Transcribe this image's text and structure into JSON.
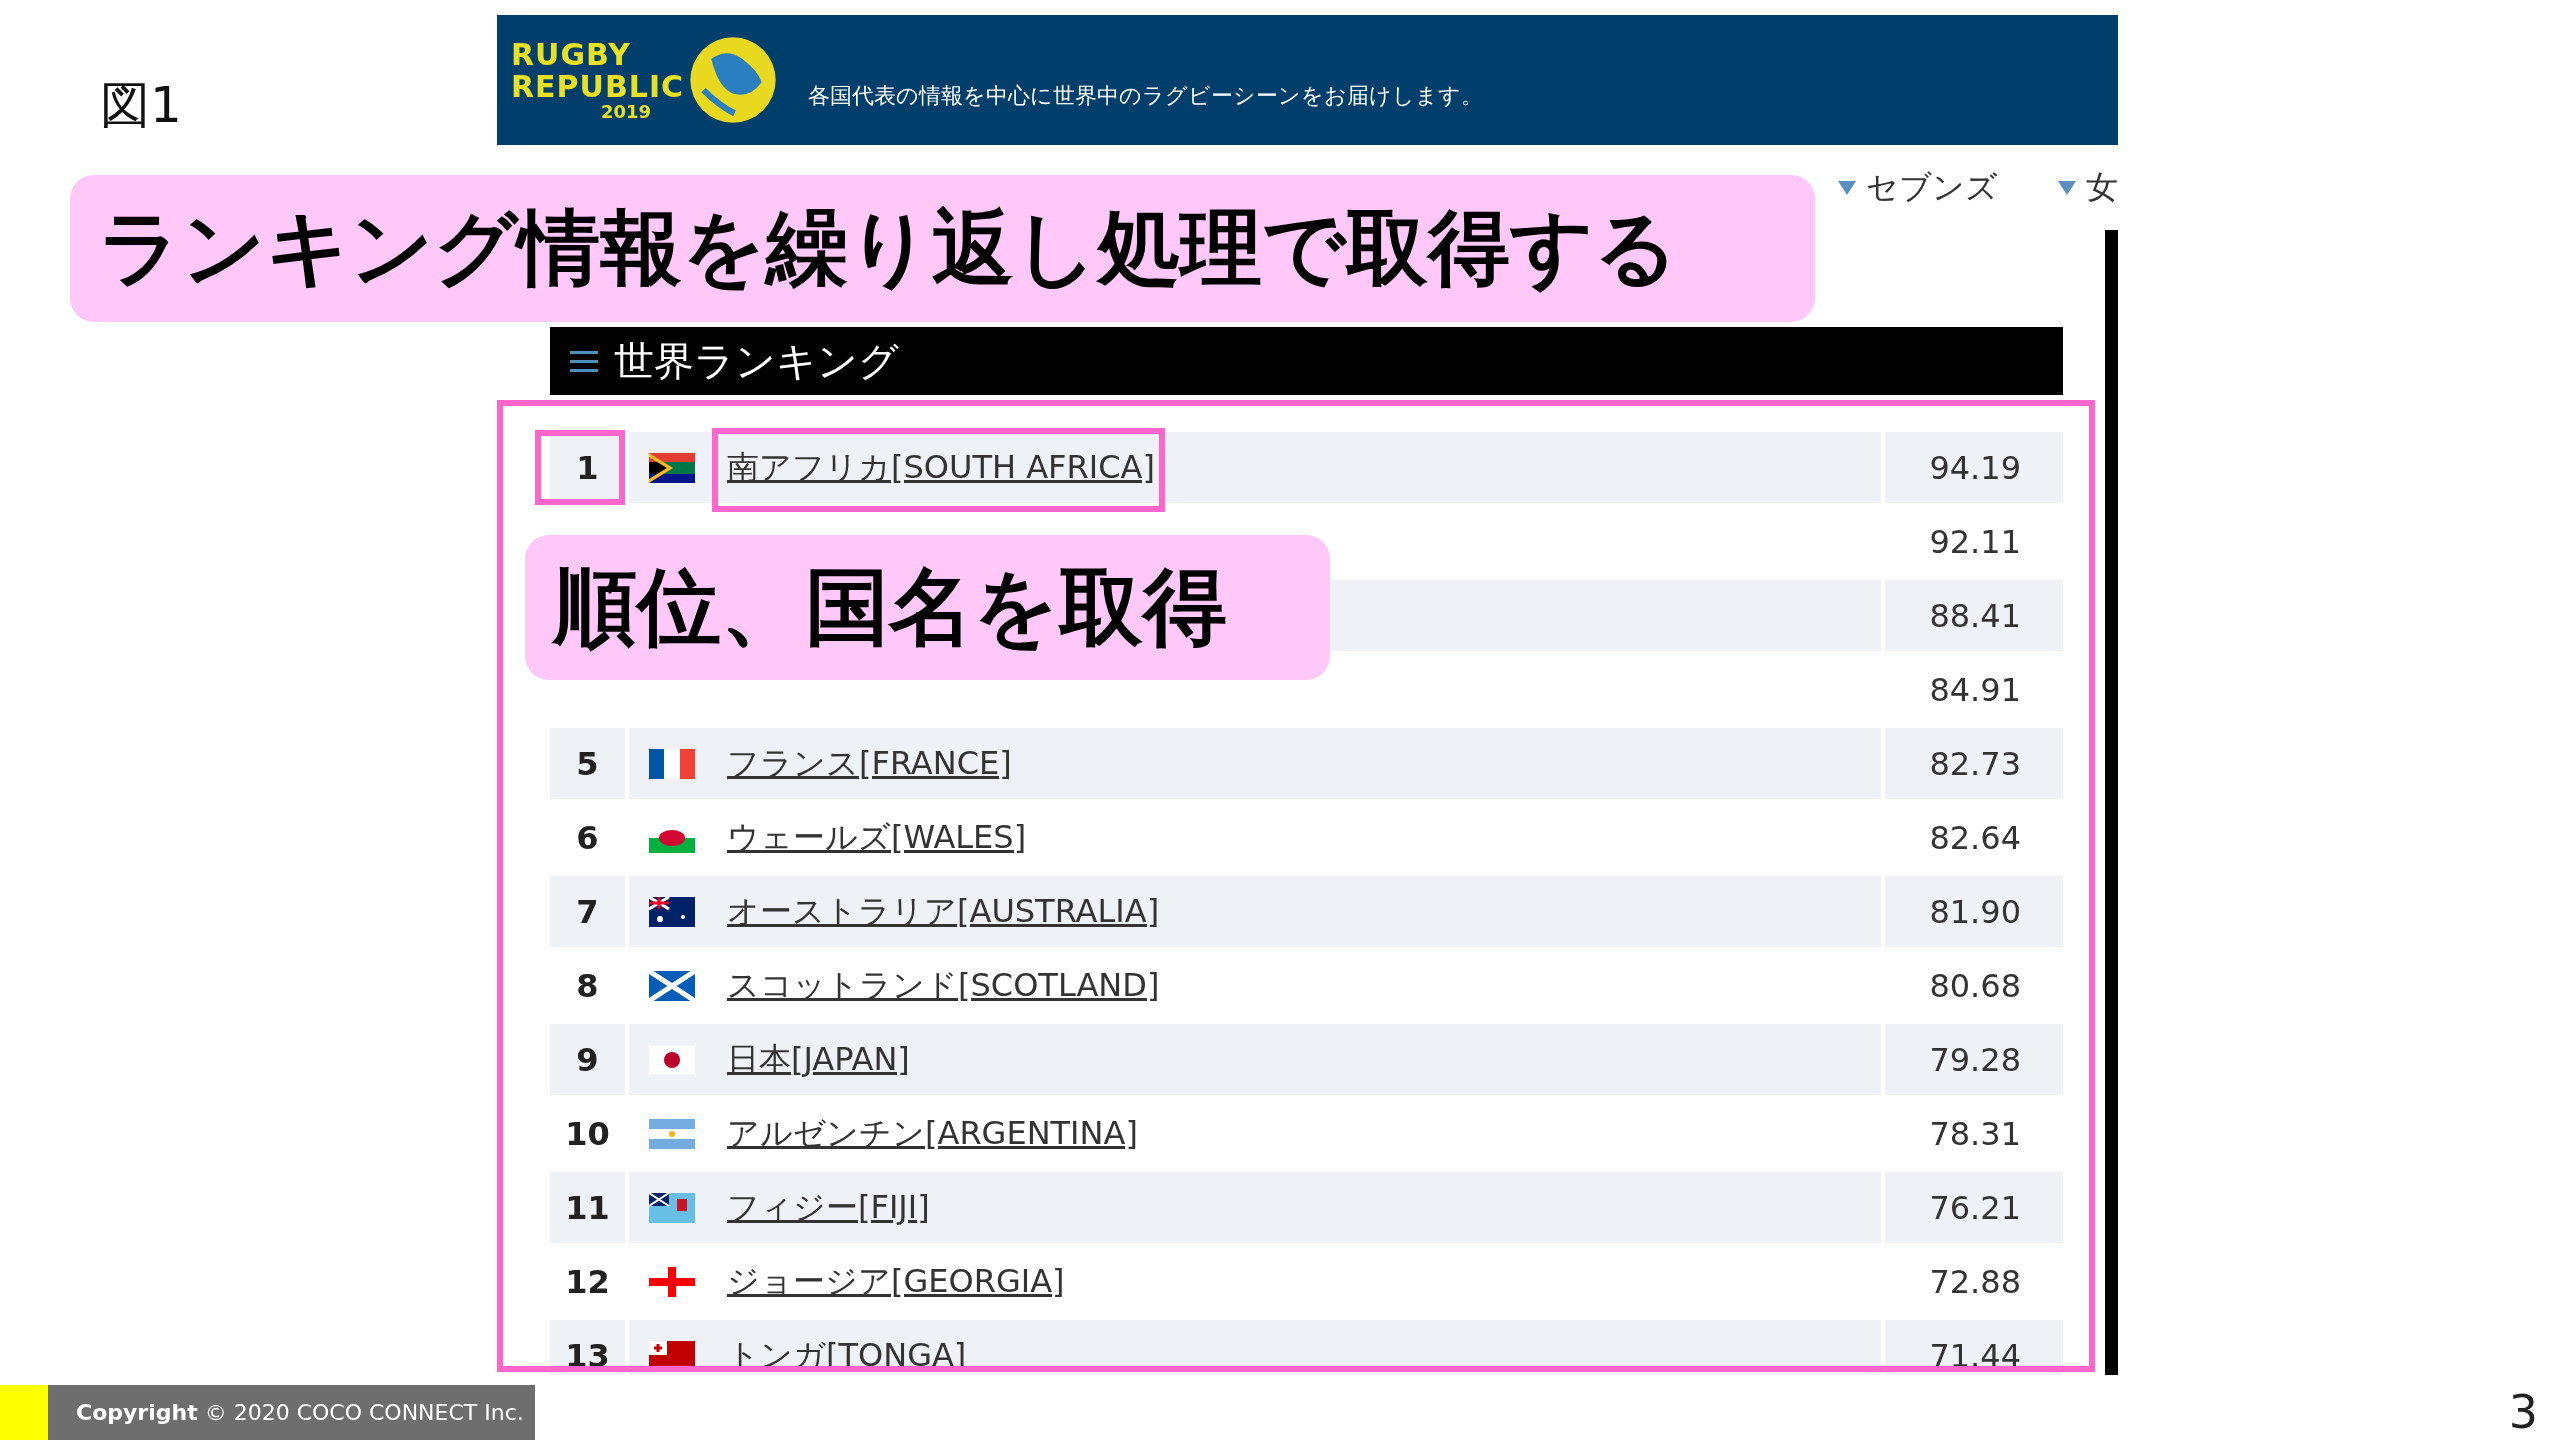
{
  "figure_label": "図1",
  "site": {
    "logo": {
      "top": "RUGBY",
      "bottom": "REPUBLIC",
      "year": "2019"
    },
    "tagline": "各国代表の情報を中心に世界中のラグビーシーンをお届けします。",
    "nav": [
      {
        "label": "セブンズ"
      },
      {
        "label": "女"
      }
    ]
  },
  "ranking": {
    "title": "世界ランキング",
    "rows": [
      {
        "rank": "1",
        "name": "南アフリカ[SOUTH AFRICA]",
        "score": "94.19"
      },
      {
        "score": "92.11"
      },
      {
        "score": "88.41"
      },
      {
        "score": "84.91"
      },
      {
        "rank": "5",
        "name": "フランス[FRANCE]",
        "score": "82.73"
      },
      {
        "rank": "6",
        "name": "ウェールズ[WALES]",
        "score": "82.64"
      },
      {
        "rank": "7",
        "name": "オーストラリア[AUSTRALIA]",
        "score": "81.90"
      },
      {
        "rank": "8",
        "name": "スコットランド[SCOTLAND]",
        "score": "80.68"
      },
      {
        "rank": "9",
        "name": "日本[JAPAN]",
        "score": "79.28"
      },
      {
        "rank": "10",
        "name": "アルゼンチン[ARGENTINA]",
        "score": "78.31"
      },
      {
        "rank": "11",
        "name": "フィジー[FIJI]",
        "score": "76.21"
      },
      {
        "rank": "12",
        "name": "ジョージア[GEORGIA]",
        "score": "72.88"
      },
      {
        "rank": "13",
        "name": "トンガ[TONGA]",
        "score": "71.44"
      }
    ]
  },
  "callouts": [
    {
      "text": "ランキング情報を繰り返し処理で取得する"
    },
    {
      "text": "順位、国名を取得"
    }
  ],
  "footer": {
    "copyright": "**Copyright** © 2020 COCO CONNECT Inc."
  },
  "page_number": "3"
}
